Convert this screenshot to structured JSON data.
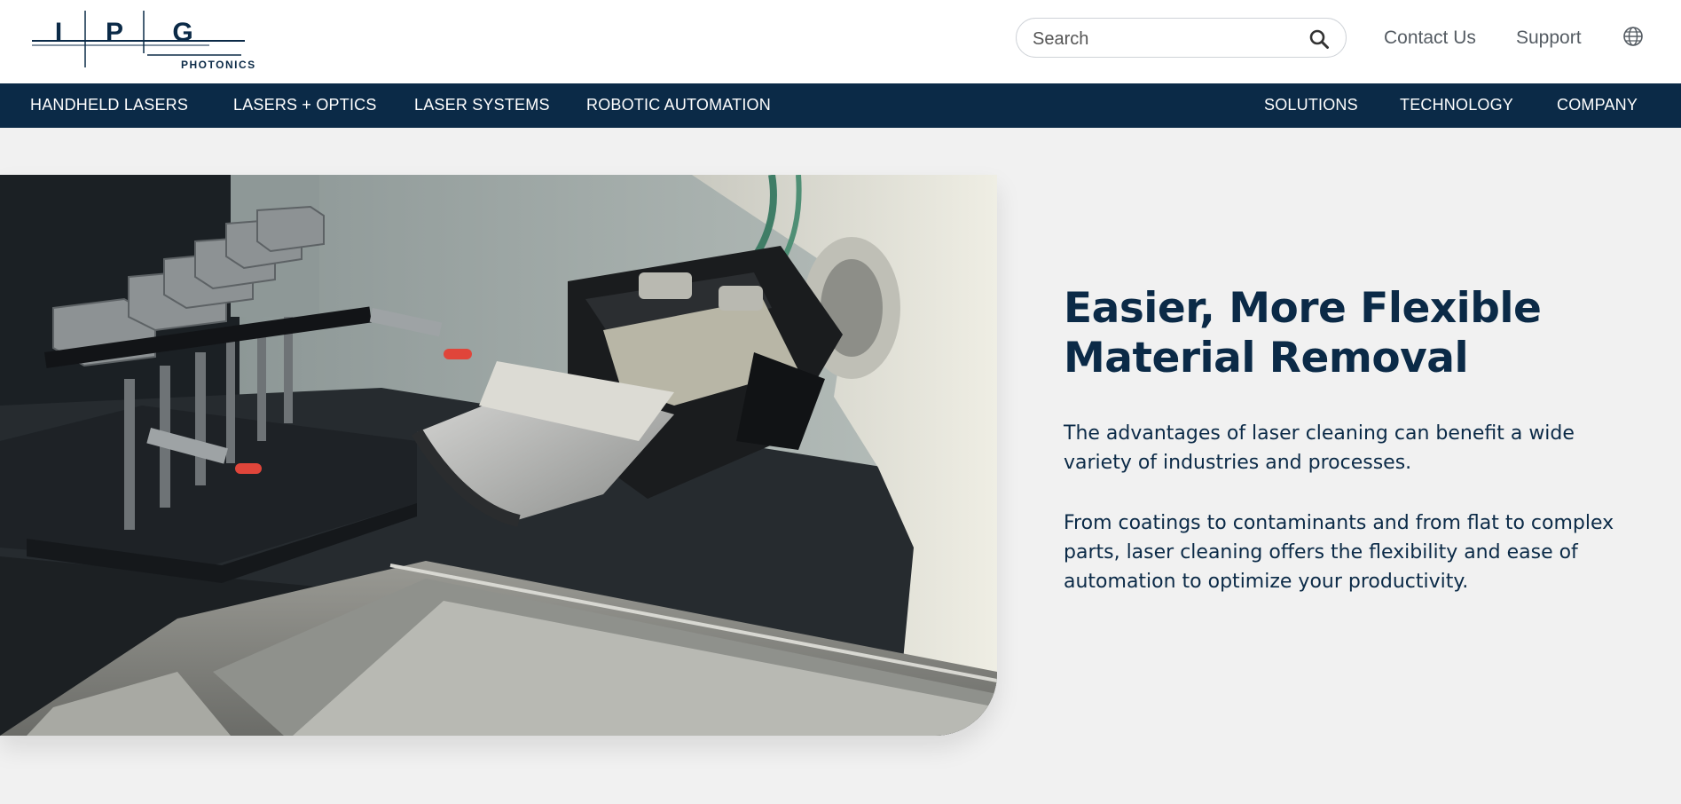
{
  "logo": {
    "letters": [
      "I",
      "P",
      "G"
    ],
    "subtitle": "PHOTONICS"
  },
  "header": {
    "search": {
      "placeholder": "Search"
    },
    "links": [
      "Contact Us",
      "Support"
    ]
  },
  "nav": {
    "left": [
      "HANDHELD LASERS",
      "LASERS + OPTICS",
      "LASER SYSTEMS",
      "ROBOTIC AUTOMATION"
    ],
    "right": [
      "SOLUTIONS",
      "TECHNOLOGY",
      "COMPANY"
    ]
  },
  "hero": {
    "title_line1": "Easier, More Flexible",
    "title_line2": "Material Removal",
    "paragraph1": "The advantages of laser cleaning can benefit a wide variety of industries and processes.",
    "paragraph2": "From coatings to contaminants and from flat to complex parts, laser cleaning offers the flexibility and ease of automation to optimize your productivity."
  },
  "icons": {
    "search": "search-icon",
    "language": "globe-icon"
  },
  "colors": {
    "brand_navy": "#0b2a47",
    "background": "#f1f1f1"
  }
}
